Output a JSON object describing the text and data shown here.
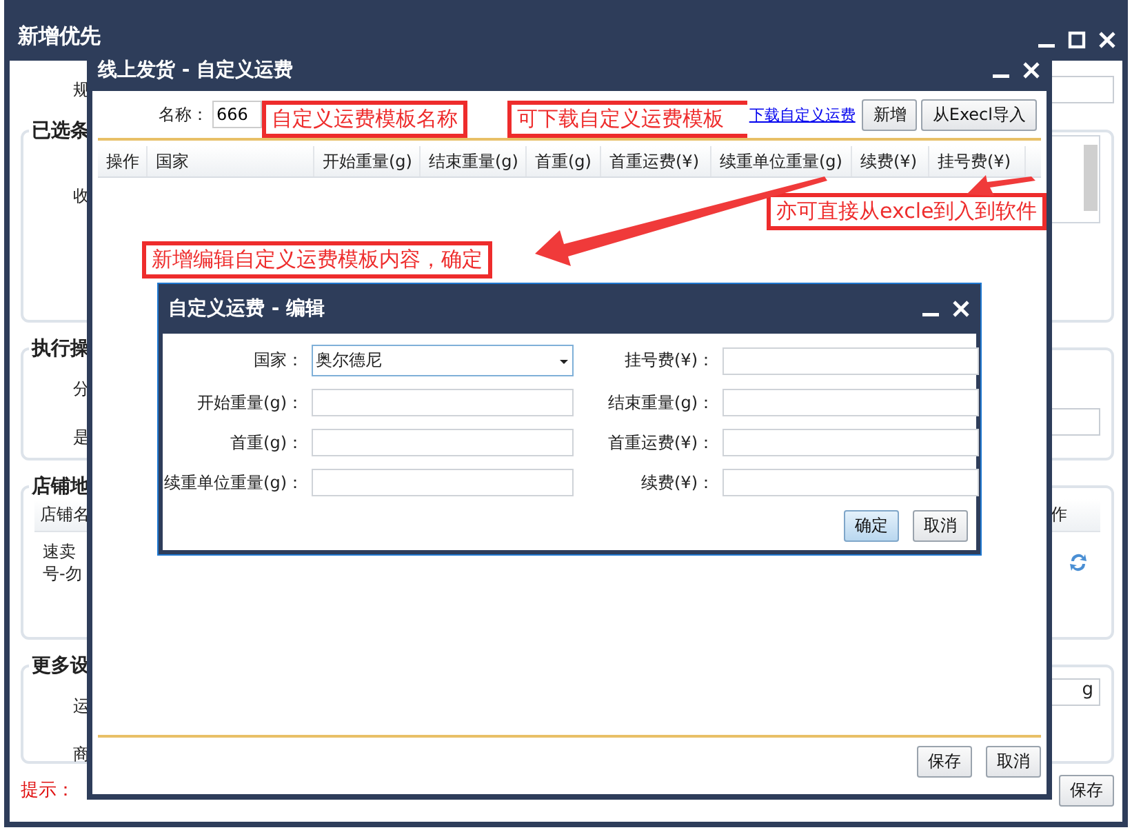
{
  "back_window": {
    "title": "新增优先",
    "rule_label": "规",
    "sections": [
      {
        "kind": "list",
        "title": "已选条",
        "labels": [
          "收"
        ]
      },
      {
        "kind": "form",
        "title": "执行操",
        "labels": [
          "分",
          "是"
        ]
      },
      {
        "kind": "table",
        "title": "店铺地",
        "header": "店铺名",
        "action_header": "作",
        "cell_lines": [
          "速卖",
          "号-勿"
        ]
      },
      {
        "kind": "form_unit",
        "title": "更多设",
        "labels": [
          "运",
          "商"
        ],
        "unit": "g"
      }
    ],
    "footer": {
      "hint": "提示：",
      "save": "保存"
    }
  },
  "shipping_dialog": {
    "title": "线上发货 - 自定义运费",
    "name_label": "名称：",
    "name_value": "666",
    "download_link": "下载自定义运费",
    "buttons": [
      "新增",
      "从Execl导入"
    ],
    "columns": [
      "操作",
      "国家",
      "开始重量(g)",
      "结束重量(g)",
      "首重(g)",
      "首重运费(¥)",
      "续重单位重量(g)",
      "续费(¥)",
      "挂号费(¥)"
    ],
    "footer_buttons": [
      "保存",
      "取消"
    ]
  },
  "edit_dialog": {
    "title": "自定义运费 - 编辑",
    "fields": [
      {
        "label": "国家：",
        "kind": "select",
        "value": "奥尔德尼"
      },
      {
        "label": "挂号费(¥)：",
        "kind": "text"
      },
      {
        "label": "开始重量(g)：",
        "kind": "text"
      },
      {
        "label": "结束重量(g)：",
        "kind": "text"
      },
      {
        "label": "首重(g)：",
        "kind": "text"
      },
      {
        "label": "首重运费(¥)：",
        "kind": "text"
      },
      {
        "label": "续重单位重量(g)：",
        "kind": "text"
      },
      {
        "label": "续费(¥)：",
        "kind": "text"
      }
    ],
    "buttons": [
      {
        "label": "确定",
        "primary": true
      },
      {
        "label": "取消",
        "primary": false
      }
    ]
  },
  "annotations": [
    {
      "text": "自定义运费模板名称"
    },
    {
      "text": "可下载自定义运费模板"
    },
    {
      "text": "亦可直接从excle到入到软件"
    },
    {
      "text": "新增编辑自定义运费模板内容，确定"
    }
  ]
}
